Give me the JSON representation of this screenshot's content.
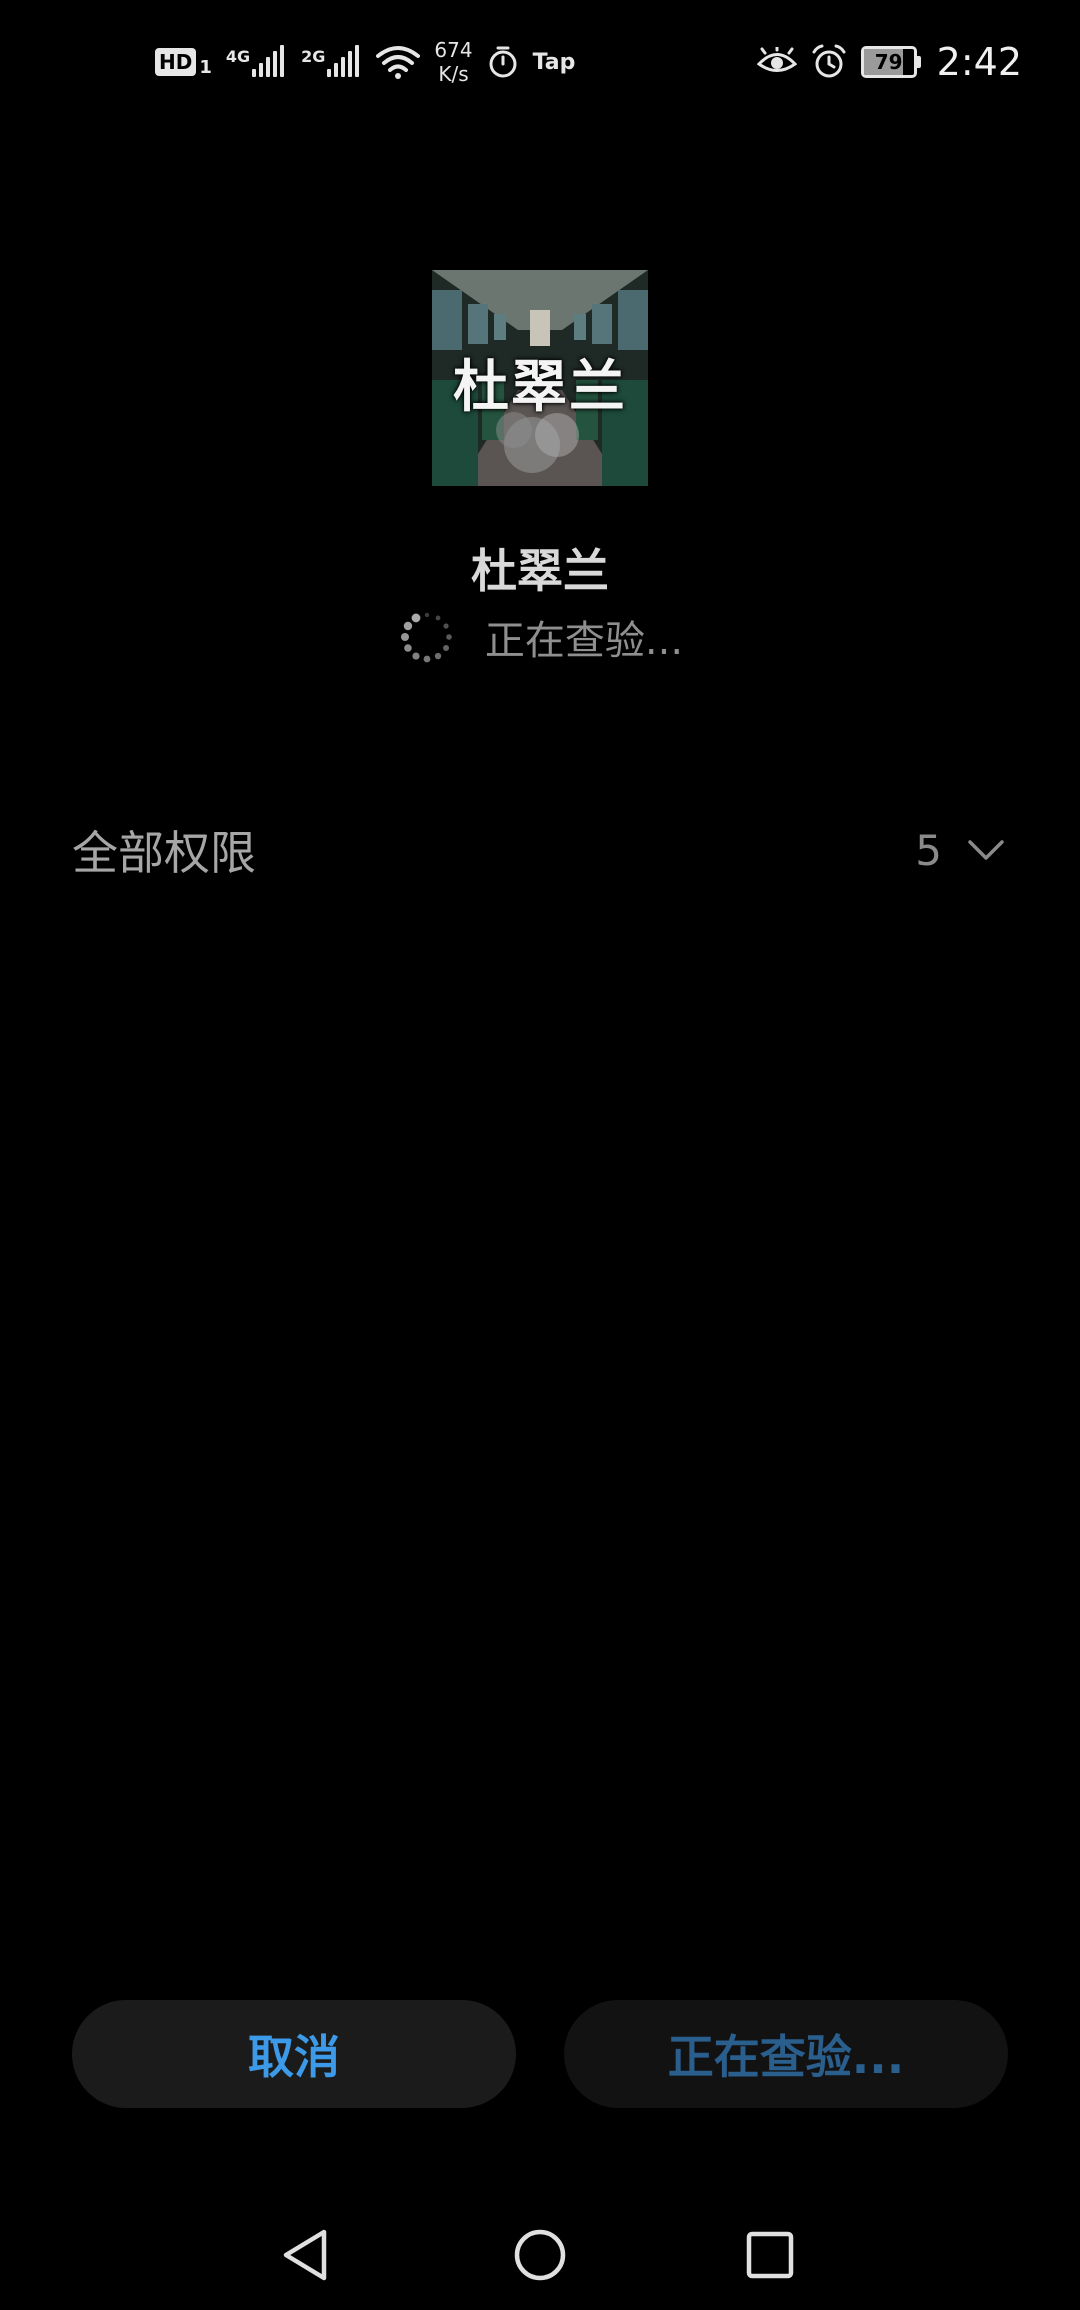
{
  "status_bar": {
    "hd_label": "HD",
    "hd_sim": "1",
    "net1_label": "4G",
    "net2_label": "2G",
    "speed_value": "674",
    "speed_unit": "K/s",
    "tap_label": "Tap",
    "battery_level": "79",
    "time": "2:42"
  },
  "app": {
    "icon_title": "杜翠兰",
    "name": "杜翠兰",
    "status": "正在查验..."
  },
  "permissions": {
    "label": "全部权限",
    "count": "5"
  },
  "buttons": {
    "cancel": "取消",
    "install": "正在查验..."
  },
  "colors": {
    "background": "#000000",
    "accent": "#3d9ae8",
    "accent_disabled": "#2a5e8c",
    "button_bg": "#1b1b1b"
  },
  "icons": {
    "status_bar": [
      "hd-icon",
      "signal-icon",
      "wifi-icon",
      "timer-icon",
      "eye-icon",
      "alarm-icon",
      "battery-icon"
    ],
    "nav": [
      "back-icon",
      "home-icon",
      "recents-icon"
    ]
  }
}
